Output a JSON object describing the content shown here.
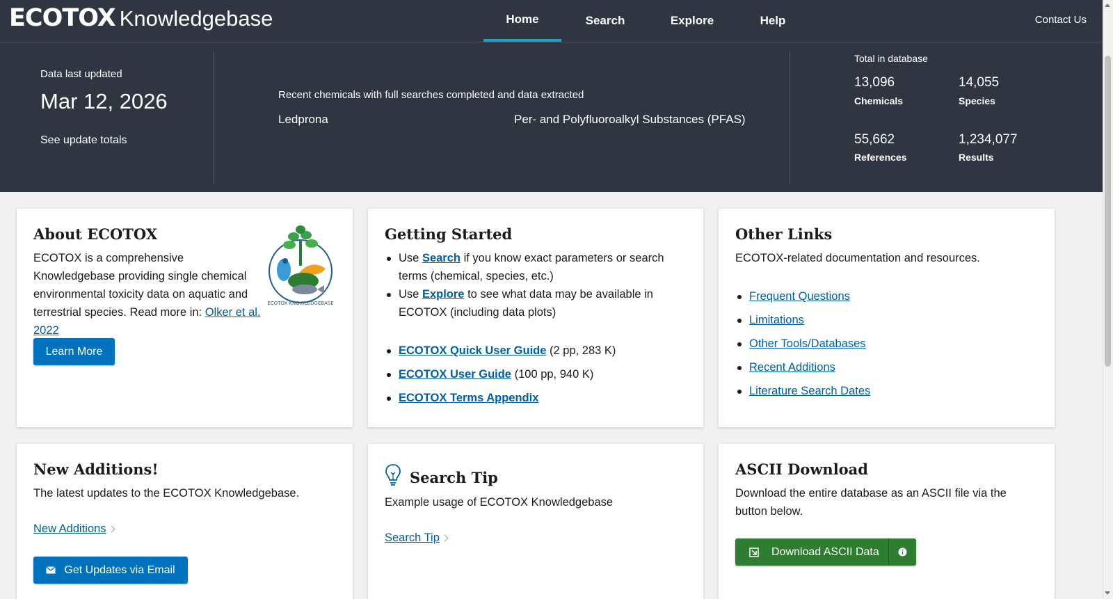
{
  "header": {
    "brand": "ECOTOX",
    "brand_suffix": "Knowledgebase",
    "nav": [
      {
        "label": "Home",
        "active": true
      },
      {
        "label": "Search",
        "active": false
      },
      {
        "label": "Explore",
        "active": false
      },
      {
        "label": "Help",
        "active": false
      }
    ],
    "contact": "Contact Us"
  },
  "banner": {
    "updated_label": "Data last updated",
    "updated_date": "Mar 12, 2026",
    "updated_link": "See update totals",
    "recent_label": "Recent chemicals with full searches completed and data extracted",
    "recent_items": [
      "Ledprona",
      "Per- and Polyfluoroalkyl Substances (PFAS)"
    ],
    "totals_label": "Total in database",
    "stats": [
      {
        "value": "13,096",
        "label": "Chemicals"
      },
      {
        "value": "14,055",
        "label": "Species"
      },
      {
        "value": "55,662",
        "label": "References"
      },
      {
        "value": "1,234,077",
        "label": "Results"
      }
    ]
  },
  "about": {
    "title": "About ECOTOX",
    "body": "ECOTOX is a comprehensive Knowledgebase providing single chemical environmental toxicity data on aquatic and terrestrial species.",
    "read_more_prefix": "Read more in:",
    "read_more_link": "Olker et al. 2022",
    "button": "Learn More",
    "logo_text": "ECOTOX KNOWLEDGEBASE"
  },
  "getting_started": {
    "title": "Getting Started",
    "item1_prefix": "Use",
    "item1_link": "Search",
    "item1_suffix": "if you know exact parameters or search terms (chemical, species, etc.)",
    "item2_prefix": "Use",
    "item2_link": "Explore",
    "item2_suffix": "to see what data may be available in ECOTOX (including data plots)",
    "guides": [
      {
        "label": "ECOTOX Quick User Guide",
        "note": "(2 pp, 283 K)"
      },
      {
        "label": "ECOTOX User Guide",
        "note": "(100 pp, 940 K)"
      },
      {
        "label": "ECOTOX Terms Appendix",
        "note": ""
      }
    ]
  },
  "other_links": {
    "title": "Other Links",
    "body": "ECOTOX-related documentation and resources.",
    "links": [
      "Frequent Questions",
      "Limitations",
      "Other Tools/Databases",
      "Recent Additions",
      "Literature Search Dates"
    ]
  },
  "new_additions": {
    "title": "New Additions!",
    "body": "The latest updates to the ECOTOX Knowledgebase.",
    "link": "New Additions",
    "button": "Get Updates via Email"
  },
  "search_tip": {
    "title": "Search Tip",
    "body": "Example usage of ECOTOX Knowledgebase",
    "link": "Search Tip"
  },
  "ascii": {
    "title": "ASCII Download",
    "body": "Download the entire database as an ASCII file via the button below.",
    "button": "Download ASCII Data"
  },
  "colors": {
    "header_bg": "#2f3541",
    "accent": "#1aa0c9",
    "link": "#005ea2",
    "primary_button": "#0071bc",
    "download_button": "#2e7d32"
  }
}
